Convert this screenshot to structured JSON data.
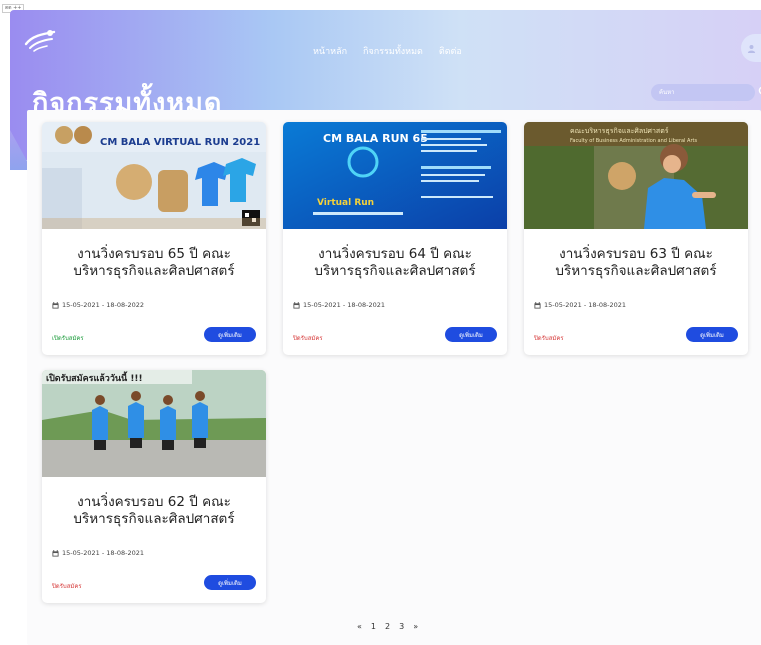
{
  "corner_tag": "ตต ++",
  "nav": {
    "items": [
      "หน้าหลัก",
      "กิจกรรมทั้งหมด",
      "ติดต่อ"
    ]
  },
  "page": {
    "title": "กิจกรรมทั้งหมด"
  },
  "search": {
    "placeholder": "ค้นหา"
  },
  "colors": {
    "accent_button": "#1f4ce0",
    "status_open": "#1a9b3a",
    "status_closed": "#d63a3a"
  },
  "cards": [
    {
      "title_line1": "งานวิ่งครบรอบ 65 ปี คณะ",
      "title_line2": "บริหารธุรกิจและศิลปศาสตร์",
      "date": "15-05-2021 - 18-08-2022",
      "status": "เปิดรับสมัคร",
      "status_kind": "open",
      "button": "ดูเพิ่มเติม",
      "image_text_1": "CM BALA VIRTUAL RUN 2021"
    },
    {
      "title_line1": "งานวิ่งครบรอบ 64 ปี คณะ",
      "title_line2": "บริหารธุรกิจและศิลปศาสตร์",
      "date": "15-05-2021 - 18-08-2021",
      "status": "ปิดรับสมัคร",
      "status_kind": "closed",
      "button": "ดูเพิ่มเติม",
      "image_text_1": "CM BALA RUN 65",
      "image_text_2": "Virtual Run"
    },
    {
      "title_line1": "งานวิ่งครบรอบ 63 ปี คณะ",
      "title_line2": "บริหารธุรกิจและศิลปศาสตร์",
      "date": "15-05-2021 - 18-08-2021",
      "status": "ปิดรับสมัคร",
      "status_kind": "closed",
      "button": "ดูเพิ่มเติม",
      "image_text_1": "คณะบริหารธุรกิจและศิลปศาสตร์",
      "image_text_2": "Faculty of Business Administration and Liberal Arts"
    },
    {
      "title_line1": "งานวิ่งครบรอบ 62 ปี คณะ",
      "title_line2": "บริหารธุรกิจและศิลปศาสตร์",
      "date": "15-05-2021 - 18-08-2021",
      "status": "ปิดรับสมัคร",
      "status_kind": "closed",
      "button": "ดูเพิ่มเติม",
      "image_text_1": "เปิดรับสมัครแล้ววันนี้ !!!"
    }
  ],
  "pagination": {
    "prev": "«",
    "pages": [
      "1",
      "2",
      "3"
    ],
    "next": "»"
  }
}
